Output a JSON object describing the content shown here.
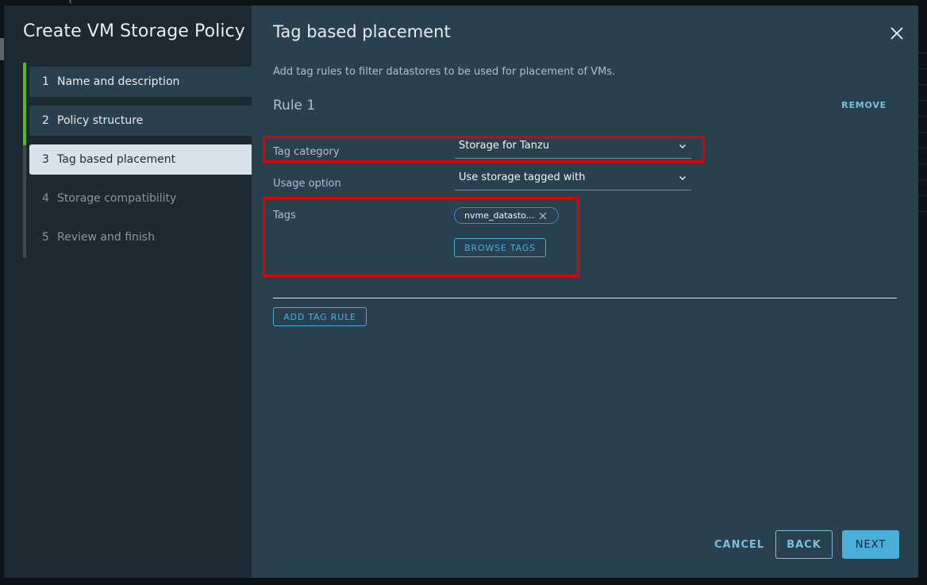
{
  "wizard": {
    "title": "Create VM Storage Policy",
    "steps": [
      {
        "num": "1",
        "label": "Name and description",
        "state": "done"
      },
      {
        "num": "2",
        "label": "Policy structure",
        "state": "done"
      },
      {
        "num": "3",
        "label": "Tag based placement",
        "state": "active"
      },
      {
        "num": "4",
        "label": "Storage compatibility",
        "state": "pending"
      },
      {
        "num": "5",
        "label": "Review and finish",
        "state": "pending"
      }
    ]
  },
  "page": {
    "title": "Tag based placement",
    "description": "Add tag rules to filter datastores to be used for placement of VMs.",
    "close_icon": "close-icon"
  },
  "rule": {
    "title": "Rule 1",
    "remove_label": "REMOVE",
    "tag_category": {
      "label": "Tag category",
      "value": "Storage for Tanzu"
    },
    "usage_option": {
      "label": "Usage option",
      "value": "Use storage tagged with"
    },
    "tags": {
      "label": "Tags",
      "items": [
        "nvme_datasto..."
      ],
      "browse_label": "BROWSE TAGS"
    }
  },
  "add_rule_label": "ADD TAG RULE",
  "footer": {
    "cancel_label": "CANCEL",
    "back_label": "BACK",
    "next_label": "NEXT"
  },
  "colors": {
    "accent": "#49afd9",
    "progress_green": "#5eb715",
    "highlight_red": "#e00000"
  }
}
